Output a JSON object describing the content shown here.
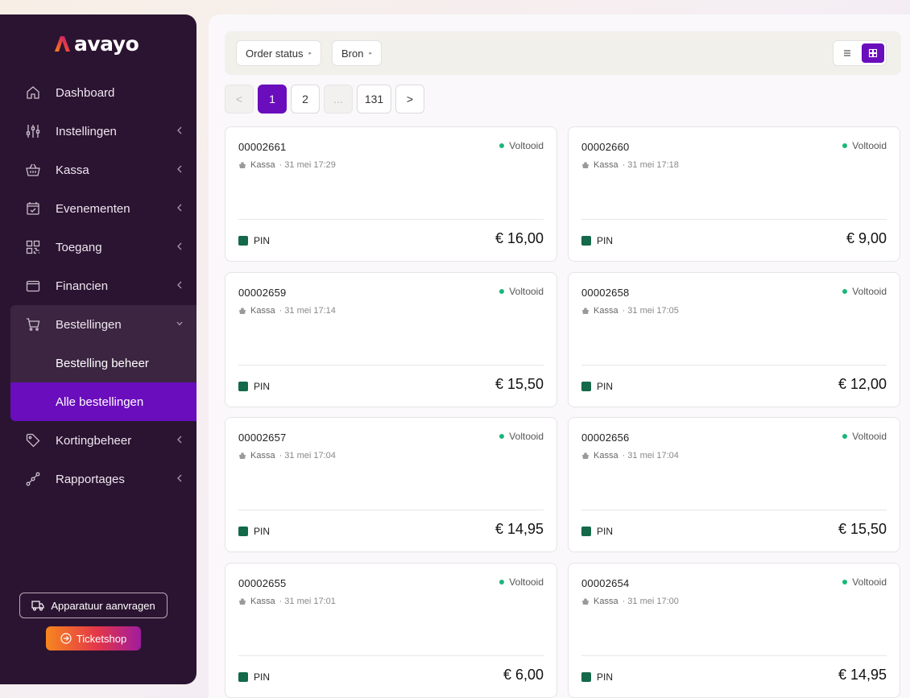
{
  "brand": {
    "name": "avayo"
  },
  "sidebar": {
    "items": [
      {
        "label": "Dashboard",
        "icon": "home-icon",
        "chevron": false
      },
      {
        "label": "Instellingen",
        "icon": "sliders-icon",
        "chevron": true
      },
      {
        "label": "Kassa",
        "icon": "basket-icon",
        "chevron": true
      },
      {
        "label": "Evenementen",
        "icon": "calendar-check-icon",
        "chevron": true
      },
      {
        "label": "Toegang",
        "icon": "qr-code-icon",
        "chevron": true
      },
      {
        "label": "Financien",
        "icon": "wallet-icon",
        "chevron": true
      },
      {
        "label": "Bestellingen",
        "icon": "cart-icon",
        "chevron": true,
        "open": true
      },
      {
        "label": "Kortingbeheer",
        "icon": "tag-icon",
        "chevron": true
      },
      {
        "label": "Rapportages",
        "icon": "route-icon",
        "chevron": true
      }
    ],
    "sub_items": [
      {
        "label": "Bestelling beheer"
      },
      {
        "label": "Alle bestellingen",
        "active": true
      }
    ],
    "device_button": "Apparatuur aanvragen",
    "ticketshop_button": "Ticketshop"
  },
  "filters": {
    "order_status": "Order status",
    "source": "Bron"
  },
  "pagination": {
    "prev": "<",
    "pages": [
      "1",
      "2",
      "...",
      "131"
    ],
    "current": "1",
    "next": ">"
  },
  "colors": {
    "sidebar_bg": "#2b1431",
    "accent": "#6a0dbd",
    "status_green": "#1bb67a",
    "pin_green": "#14694a"
  },
  "orders": [
    {
      "number": "00002661",
      "status": "Voltooid",
      "source": "Kassa",
      "date": "· 31 mei 17:29",
      "payment": "PIN",
      "amount": "€ 16,00"
    },
    {
      "number": "00002660",
      "status": "Voltooid",
      "source": "Kassa",
      "date": "· 31 mei 17:18",
      "payment": "PIN",
      "amount": "€ 9,00"
    },
    {
      "number": "00002659",
      "status": "Voltooid",
      "source": "Kassa",
      "date": "· 31 mei 17:14",
      "payment": "PIN",
      "amount": "€ 15,50"
    },
    {
      "number": "00002658",
      "status": "Voltooid",
      "source": "Kassa",
      "date": "· 31 mei 17:05",
      "payment": "PIN",
      "amount": "€ 12,00"
    },
    {
      "number": "00002657",
      "status": "Voltooid",
      "source": "Kassa",
      "date": "· 31 mei 17:04",
      "payment": "PIN",
      "amount": "€ 14,95"
    },
    {
      "number": "00002656",
      "status": "Voltooid",
      "source": "Kassa",
      "date": "· 31 mei 17:04",
      "payment": "PIN",
      "amount": "€ 15,50"
    },
    {
      "number": "00002655",
      "status": "Voltooid",
      "source": "Kassa",
      "date": "· 31 mei 17:01",
      "payment": "PIN",
      "amount": "€ 6,00"
    },
    {
      "number": "00002654",
      "status": "Voltooid",
      "source": "Kassa",
      "date": "· 31 mei 17:00",
      "payment": "PIN",
      "amount": "€ 14,95"
    }
  ]
}
